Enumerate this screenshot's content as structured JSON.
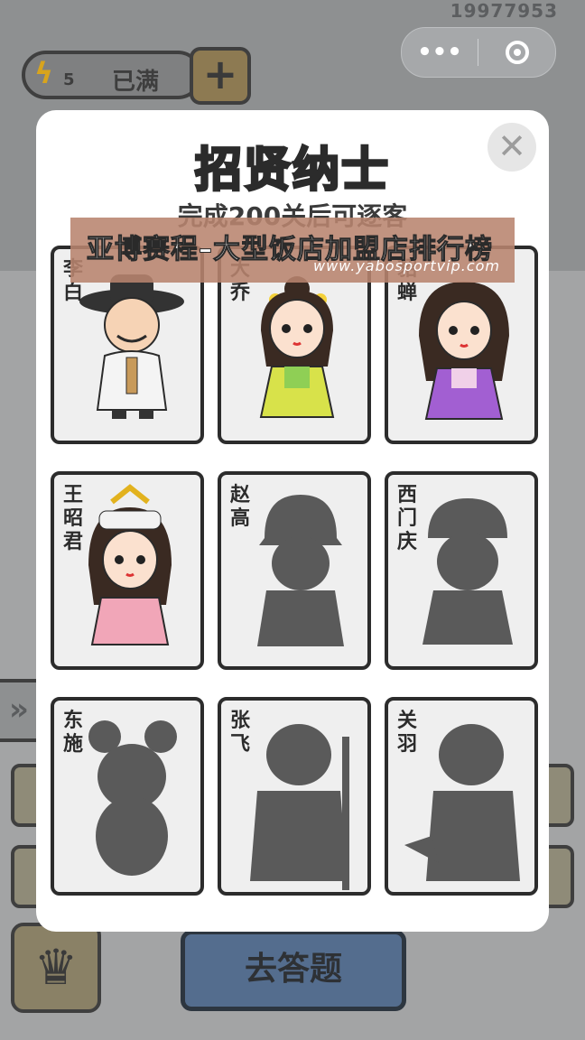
{
  "hud": {
    "score": "19977953",
    "energy_count": "5",
    "energy_status": "已满",
    "plus_icon": "plus-icon",
    "capsule_menu_icon": "more-dots-icon",
    "capsule_close_icon": "target-circle-icon"
  },
  "modal": {
    "title": "招贤纳士",
    "subtitle": "完成200关后可逐客",
    "close_icon": "close-x-icon",
    "characters": [
      {
        "name": "李白",
        "unlocked": true
      },
      {
        "name": "大乔",
        "unlocked": true
      },
      {
        "name": "貂蝉",
        "unlocked": true
      },
      {
        "name": "王昭君",
        "unlocked": true
      },
      {
        "name": "赵高",
        "unlocked": false
      },
      {
        "name": "西门庆",
        "unlocked": false
      },
      {
        "name": "东施",
        "unlocked": false
      },
      {
        "name": "张飞",
        "unlocked": false
      },
      {
        "name": "关羽",
        "unlocked": false
      }
    ]
  },
  "banner": {
    "headline": "亚博赛程–大型饭店加盟店排行榜",
    "url": "www.yabosportvip.com"
  },
  "bottom": {
    "answer_button": "去答题",
    "trophy_icon": "trophy-icon",
    "arrows_icon": "double-chevron-right-icon"
  },
  "colors": {
    "title_yellow": "#f4c21a",
    "overlay_bg": "#a9aaab",
    "answer_blue": "#546d8e"
  }
}
